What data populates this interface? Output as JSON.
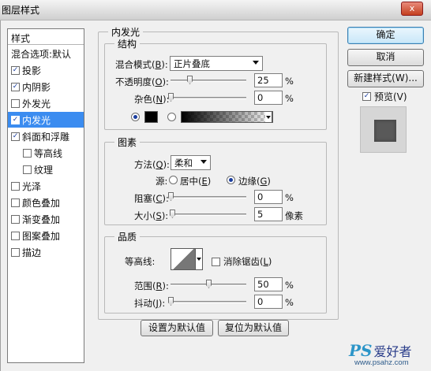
{
  "window": {
    "title": "图层样式",
    "close_glyph": "x"
  },
  "styles_panel": {
    "header": "样式",
    "items": [
      {
        "label": "混合选项:默认",
        "checkbox": false,
        "checked": false,
        "indent": false,
        "selected": false
      },
      {
        "label": "投影",
        "checkbox": true,
        "checked": true,
        "indent": false,
        "selected": false
      },
      {
        "label": "内阴影",
        "checkbox": true,
        "checked": true,
        "indent": false,
        "selected": false
      },
      {
        "label": "外发光",
        "checkbox": true,
        "checked": false,
        "indent": false,
        "selected": false
      },
      {
        "label": "内发光",
        "checkbox": true,
        "checked": true,
        "indent": false,
        "selected": true
      },
      {
        "label": "斜面和浮雕",
        "checkbox": true,
        "checked": true,
        "indent": false,
        "selected": false
      },
      {
        "label": "等高线",
        "checkbox": true,
        "checked": false,
        "indent": true,
        "selected": false
      },
      {
        "label": "纹理",
        "checkbox": true,
        "checked": false,
        "indent": true,
        "selected": false
      },
      {
        "label": "光泽",
        "checkbox": true,
        "checked": false,
        "indent": false,
        "selected": false
      },
      {
        "label": "颜色叠加",
        "checkbox": true,
        "checked": false,
        "indent": false,
        "selected": false
      },
      {
        "label": "渐变叠加",
        "checkbox": true,
        "checked": false,
        "indent": false,
        "selected": false
      },
      {
        "label": "图案叠加",
        "checkbox": true,
        "checked": false,
        "indent": false,
        "selected": false
      },
      {
        "label": "描边",
        "checkbox": true,
        "checked": false,
        "indent": false,
        "selected": false
      }
    ]
  },
  "inner_glow": {
    "title": "内发光",
    "structure": {
      "title": "结构",
      "blend_mode_label": "混合模式(",
      "blend_mode_key": "B",
      "blend_mode_value": "正片叠底",
      "opacity_label": "不透明度(",
      "opacity_key": "O",
      "opacity_value": "25",
      "opacity_level": 0.25,
      "noise_label": "杂色(",
      "noise_key": "N",
      "noise_value": "0",
      "noise_level": 0,
      "percent": "%",
      "color": "#000000"
    },
    "elements": {
      "title": "图素",
      "method_label": "方法(",
      "method_key": "Q",
      "method_value": "柔和",
      "source_label": "源:",
      "source_center": "居中(",
      "source_center_key": "E",
      "source_edge": "边缘(",
      "source_edge_key": "G",
      "source_selected": "edge",
      "choke_label": "阻塞(",
      "choke_key": "C",
      "choke_value": "0",
      "choke_level": 0,
      "size_label": "大小(",
      "size_key": "S",
      "size_value": "5",
      "size_unit": "像素",
      "size_level": 0.02
    },
    "quality": {
      "title": "品质",
      "contour_label": "等高线:",
      "anti_alias_label": "消除锯齿(",
      "anti_alias_key": "L",
      "anti_alias_checked": false,
      "range_label": "范围(",
      "range_key": "R",
      "range_value": "50",
      "range_level": 0.5,
      "jitter_label": "抖动(",
      "jitter_key": "J",
      "jitter_value": "0",
      "jitter_level": 0
    },
    "set_default": "设置为默认值",
    "reset_default": "复位为默认值"
  },
  "actions": {
    "ok": "确定",
    "cancel": "取消",
    "new_style": "新建样式(W)...",
    "preview_label": "预览(V)",
    "preview_checked": true
  },
  "watermark": {
    "ps": "PS",
    "cn": "爱好者",
    "url": "www.psahz.com"
  }
}
